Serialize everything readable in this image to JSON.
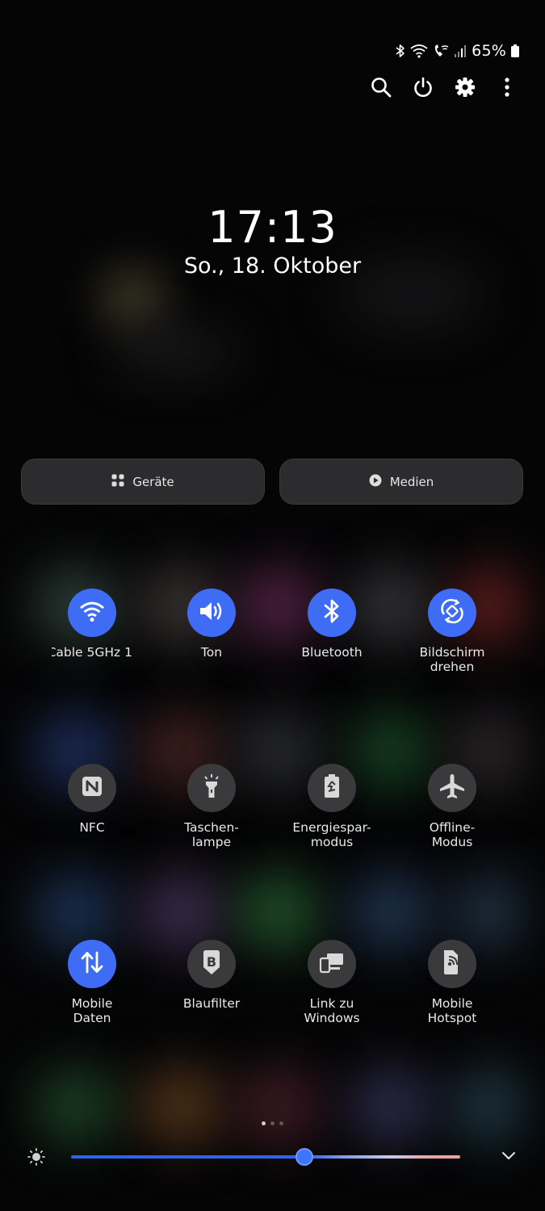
{
  "status_bar": {
    "battery_text": "65%",
    "icons": [
      "bluetooth-icon",
      "wifi-icon",
      "wifi-calling-icon",
      "signal-icon",
      "battery-icon"
    ]
  },
  "top_actions": [
    "search-icon",
    "power-icon",
    "settings-icon",
    "more-options-icon"
  ],
  "clock": {
    "time": "17:13",
    "date": "So., 18. Oktober"
  },
  "buttons": {
    "devices": "Geräte",
    "media": "Medien"
  },
  "tiles": [
    {
      "label": "1 Cable 5GHz",
      "icon": "wifi-icon",
      "state": "on"
    },
    {
      "label": "Ton",
      "icon": "sound-icon",
      "state": "on"
    },
    {
      "label": "Bluetooth",
      "icon": "bluetooth-icon",
      "state": "on"
    },
    {
      "label": "Bildschirm\ndrehen",
      "icon": "auto-rotate-icon",
      "state": "on"
    },
    {
      "label": "NFC",
      "icon": "nfc-icon",
      "state": "off"
    },
    {
      "label": "Taschen-\nlampe",
      "icon": "flashlight-icon",
      "state": "off"
    },
    {
      "label": "Energiespar-\nmodus",
      "icon": "power-saving-icon",
      "state": "off"
    },
    {
      "label": "Offline-\nModus",
      "icon": "airplane-icon",
      "state": "off"
    },
    {
      "label": "Mobile\nDaten",
      "icon": "mobile-data-icon",
      "state": "on"
    },
    {
      "label": "Blaufilter",
      "icon": "blue-light-filter-icon",
      "state": "off"
    },
    {
      "label": "Link zu\nWindows",
      "icon": "link-to-windows-icon",
      "state": "off"
    },
    {
      "label": "Mobile\nHotspot",
      "icon": "mobile-hotspot-icon",
      "state": "off"
    }
  ],
  "page_indicator": {
    "total": 3,
    "active": 1
  },
  "brightness": {
    "level": 0.6
  },
  "colors": {
    "accent": "#3e6cf5",
    "tile_off": "#3a3a3d",
    "pill_bg": "#2c2c2e"
  }
}
